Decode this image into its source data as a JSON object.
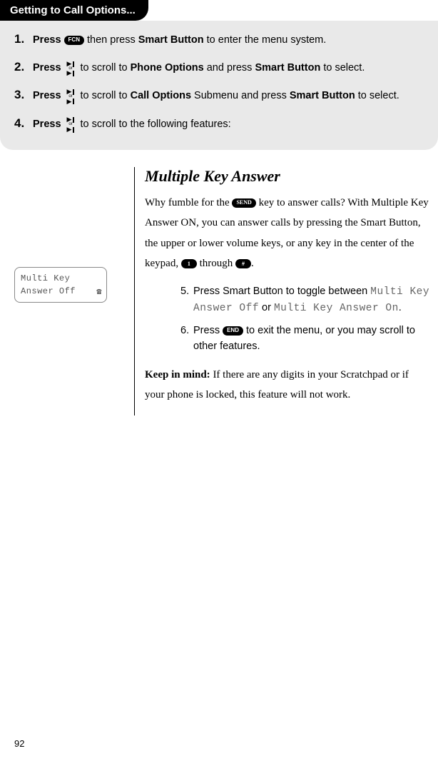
{
  "header": {
    "title": "Getting to Call Options..."
  },
  "steps": [
    {
      "num": "1.",
      "lead": "Press",
      "pill": "FCN",
      "after_pill": " then press ",
      "bold1": "Smart Button",
      "tail": " to enter the menu system."
    },
    {
      "num": "2.",
      "lead": "Press",
      "after_icon": " to scroll to ",
      "bold1": "Phone Options",
      "mid": " and press ",
      "bold2": "Smart Button",
      "tail": " to select."
    },
    {
      "num": "3.",
      "lead": "Press",
      "after_icon": " to scroll to ",
      "bold1": "Call Options",
      "mid": " Submenu and press ",
      "bold2": "Smart Button",
      "tail": " to select."
    },
    {
      "num": "4.",
      "lead": "Press",
      "after_icon": " to scroll to the following features:"
    }
  ],
  "lcd": {
    "line1": "Multi Key",
    "line2": "Answer Off"
  },
  "section": {
    "title": "Multiple Key Answer",
    "intro_a": "Why fumble for the ",
    "intro_pill": "SEND",
    "intro_b": " key to answer calls? With Multiple Key Answer ON, you can answer calls by pressing the Smart Button, the upper or lower volume keys, or any key in the center of the keypad, ",
    "intro_pill2": "1",
    "intro_c": " through ",
    "intro_pill3": "#",
    "intro_d": ".",
    "sub5_a": "Press Smart Button to toggle between ",
    "sub5_m1": "Multi Key Answer Off",
    "sub5_b": " or ",
    "sub5_m2": "Multi Key Answer On",
    "sub5_c": ".",
    "sub6_a": "Press ",
    "sub6_pill": "END",
    "sub6_b": " to exit the menu, or you may scroll to other features.",
    "note_lead": "Keep in mind:",
    "note": " If there are any digits in your Scratchpad or if your phone is locked, this feature will not work."
  },
  "page_number": "92"
}
